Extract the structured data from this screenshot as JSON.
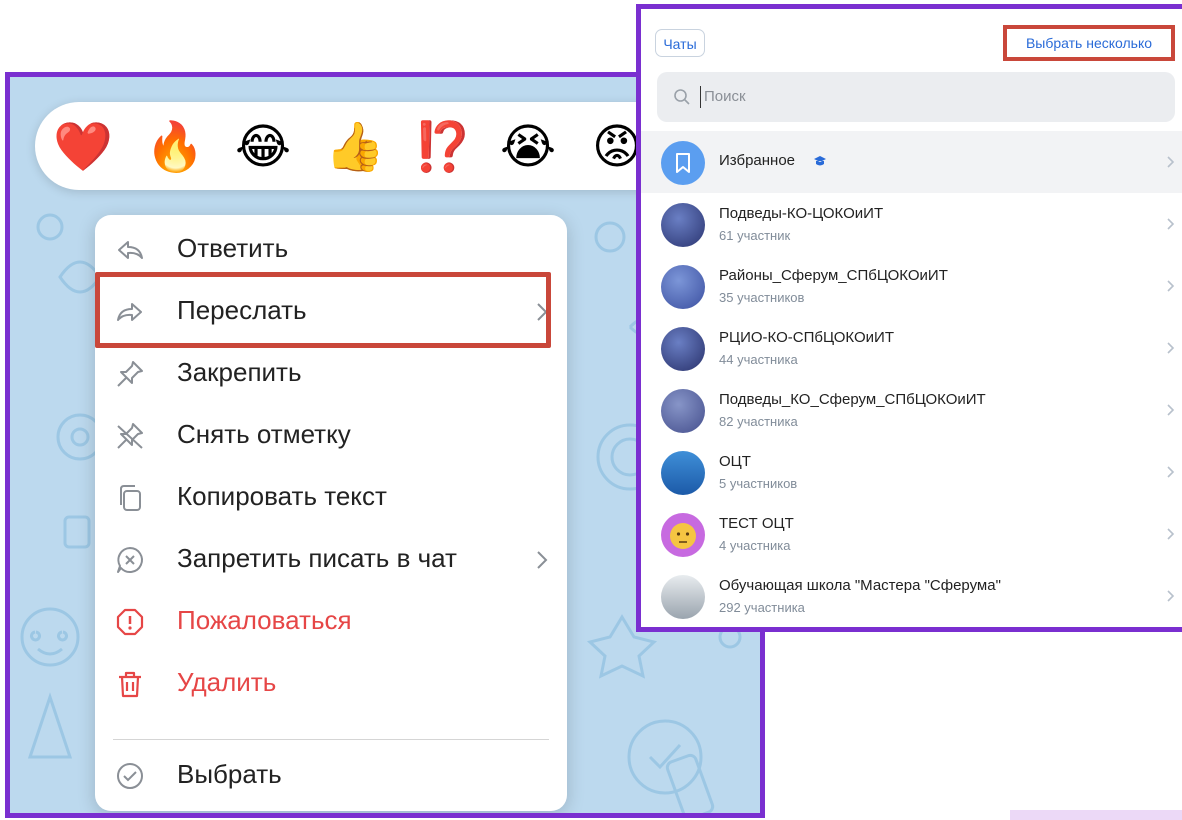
{
  "reactions": [
    "❤️",
    "🔥",
    "😂",
    "👍",
    "⁉️",
    "😭",
    "😡"
  ],
  "context_menu": {
    "items": [
      {
        "label": "Ответить",
        "icon": "reply-icon"
      },
      {
        "label": "Переслать",
        "icon": "forward-icon"
      },
      {
        "label": "Закрепить",
        "icon": "pin-icon"
      },
      {
        "label": "Снять отметку",
        "icon": "unpin-icon"
      },
      {
        "label": "Копировать текст",
        "icon": "copy-icon"
      },
      {
        "label": "Запретить писать в чат",
        "icon": "mute-icon"
      },
      {
        "label": "Пожаловаться",
        "icon": "report-icon"
      },
      {
        "label": "Удалить",
        "icon": "trash-icon"
      },
      {
        "label": "Выбрать",
        "icon": "check-circle-icon"
      }
    ]
  },
  "share_panel": {
    "chats_label": "Чаты",
    "select_many_label": "Выбрать несколько",
    "search_placeholder": "Поиск",
    "chats": [
      {
        "name": "Избранное",
        "subtitle": ""
      },
      {
        "name": "Подведы-КО-ЦОКОиИТ",
        "subtitle": "61 участник"
      },
      {
        "name": "Районы_Сферум_СПбЦОКОиИТ",
        "subtitle": "35 участников"
      },
      {
        "name": "РЦИО-КО-СПбЦОКОиИТ",
        "subtitle": "44 участника"
      },
      {
        "name": "Подведы_КО_Сферум_СПбЦОКОиИТ",
        "subtitle": "82 участника"
      },
      {
        "name": "ОЦТ",
        "subtitle": "5 участников"
      },
      {
        "name": "ТЕСТ ОЦТ",
        "subtitle": "4 участника"
      },
      {
        "name": "Обучающая школа \"Мастера \"Сферума\"",
        "subtitle": "292 участника"
      }
    ]
  },
  "colors": {
    "highlight_frame": "#7a2fd0",
    "highlight_box": "#c9473a",
    "accent_blue": "#2a6bd8",
    "danger_red": "#e64646"
  }
}
